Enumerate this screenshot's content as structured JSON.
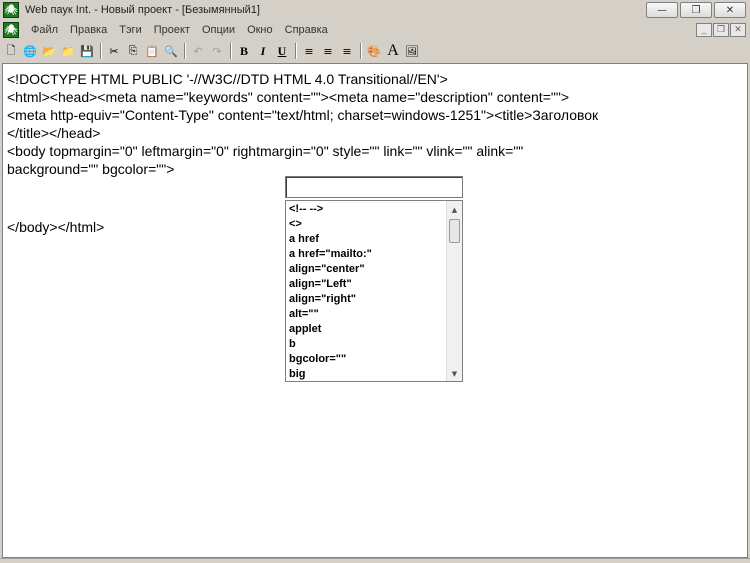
{
  "window": {
    "title": "Web паук Int. - Новый проект - [Безымянный1]",
    "app_icon_glyph": "🕷",
    "buttons": {
      "minimize": "—",
      "restore": "❐",
      "close": "✕"
    }
  },
  "menubar": {
    "items": [
      "Файл",
      "Правка",
      "Тэги",
      "Проект",
      "Опции",
      "Окно",
      "Справка"
    ],
    "mdi_buttons": {
      "minimize": "_",
      "restore": "❐",
      "close": "✕"
    }
  },
  "toolbar": {
    "icons": {
      "new": "🗋",
      "open_web": "🌐",
      "open": "📂",
      "open_project": "📁",
      "save": "💾",
      "cut": "✂",
      "copy": "⎘",
      "paste": "📋",
      "find": "🔍",
      "undo": "↶",
      "redo": "↷",
      "bold": "B",
      "italic": "I",
      "underline": "U",
      "align_left": "≡",
      "align_center": "≡",
      "align_right": "≡",
      "palette": "🎨",
      "font": "A",
      "image": "🖼"
    }
  },
  "editor": {
    "lines": [
      "<!DOCTYPE HTML PUBLIC '-//W3C//DTD HTML 4.0 Transitional//EN'>",
      "<html><head><meta name=\"keywords\" content=\"\"><meta name=\"description\" content=\"\">",
      "<meta http-equiv=\"Content-Type\" content=\"text/html; charset=windows-1251\"><title>Заголовок",
      "</title></head>",
      "<body topmargin=\"0\" leftmargin=\"0\" rightmargin=\"0\" style=\"\" link=\"\" vlink=\"\" alink=\"\"",
      "background=\"\" bgcolor=\"\">",
      "",
      "</body></html>"
    ]
  },
  "autocomplete": {
    "input_value": "",
    "items": [
      "<!-- -->",
      "<>",
      "a href",
      "a href=\"mailto:\"",
      "align=\"center\"",
      "align=\"Left\"",
      "align=\"right\"",
      "alt=\"\"",
      "applet",
      "b",
      "bgcolor=\"\"",
      "big"
    ],
    "scroll_up": "▲",
    "scroll_down": "▼"
  }
}
